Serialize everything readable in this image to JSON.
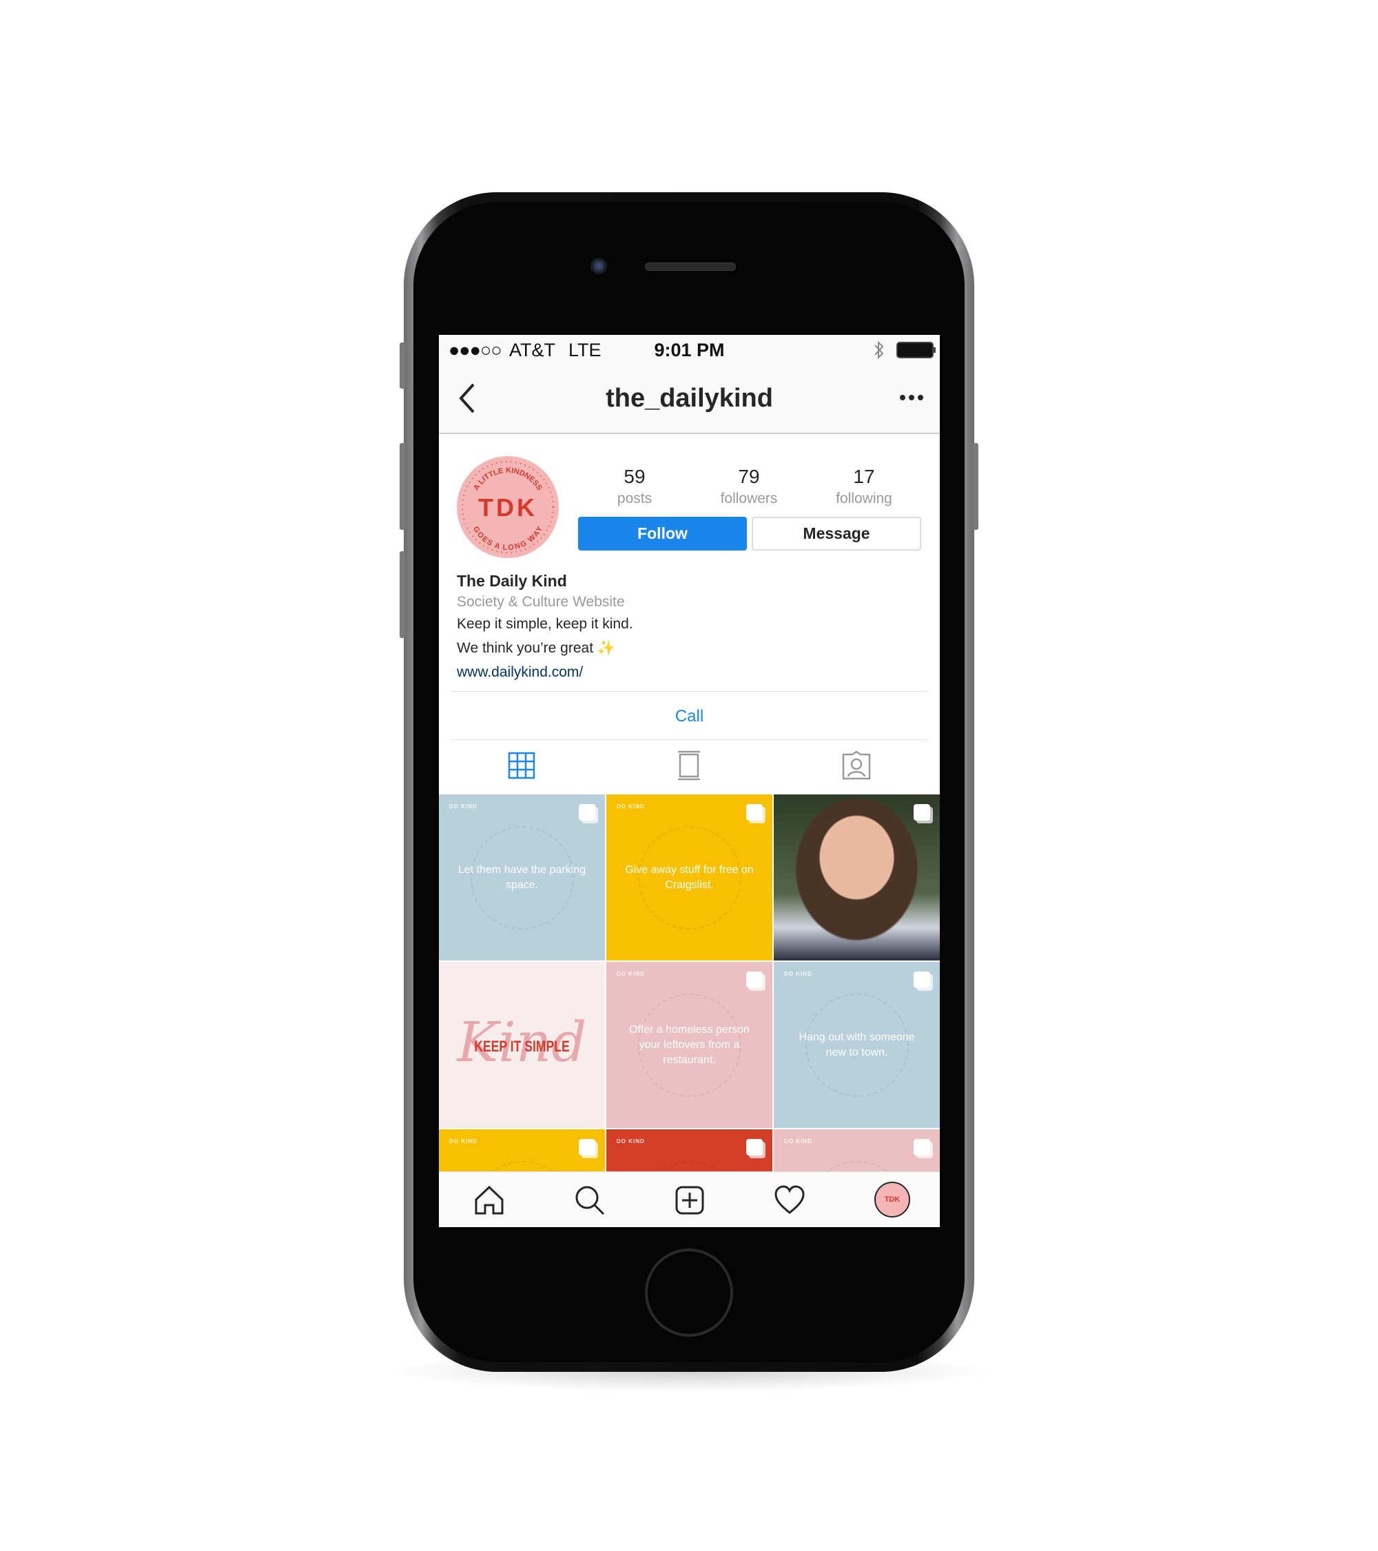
{
  "status_bar": {
    "signal": "●●●○○",
    "carrier": "AT&T",
    "network": "LTE",
    "time": "9:01 PM",
    "bluetooth_icon": "bluetooth-icon",
    "battery_icon": "battery-icon"
  },
  "nav": {
    "back_icon": "chevron-left-icon",
    "title": "the_dailykind",
    "more_icon": "more-horizontal-icon"
  },
  "profile": {
    "avatar_text": "TDK",
    "avatar_ring_top": "A LITTLE KINDNESS",
    "avatar_ring_bottom": "GOES A LONG WAY",
    "stats": [
      {
        "value": "59",
        "label": "posts"
      },
      {
        "value": "79",
        "label": "followers"
      },
      {
        "value": "17",
        "label": "following"
      }
    ],
    "follow_label": "Follow",
    "message_label": "Message",
    "name": "The Daily Kind",
    "category": "Society & Culture Website",
    "bio_lines": [
      "Keep it simple, keep it kind.",
      "We think you’re great ✨"
    ],
    "website": "www.dailykind.com/",
    "call_label": "Call"
  },
  "tabs": [
    "grid-icon",
    "feed-icon",
    "tagged-icon"
  ],
  "posts": [
    {
      "tag": "DO KIND",
      "text": "Let them have the parking space.",
      "color": "#b8cfdc"
    },
    {
      "tag": "DO KIND",
      "text": "Give away stuff for free on Craigslist.",
      "color": "#f8c000"
    },
    {
      "tag": "",
      "text": "",
      "color": "#3b4a30",
      "photo": true
    },
    {
      "tag": "",
      "text": "KEEP IT SIMPLE",
      "script": "Kind",
      "color": "#f8eded"
    },
    {
      "tag": "DO KIND",
      "text": "Offer a homeless person your leftovers from a restaurant.",
      "color": "#ebc0c3"
    },
    {
      "tag": "DO KIND",
      "text": "Hang out with someone new to town.",
      "color": "#b8cfdc"
    },
    {
      "tag": "DO KIND",
      "text": "",
      "color": "#f8c000"
    },
    {
      "tag": "DO KIND",
      "text": "",
      "color": "#d63f27"
    },
    {
      "tag": "DO KIND",
      "text": "",
      "color": "#ebc0c3"
    }
  ],
  "colors": {
    "accent": "#1a86ec",
    "link": "#003569",
    "brand_red": "#d8382a",
    "brand_pink": "#f3b6b5"
  },
  "bottom_nav": [
    "home-icon",
    "search-icon",
    "add-post-icon",
    "heart-icon",
    "profile-avatar"
  ]
}
